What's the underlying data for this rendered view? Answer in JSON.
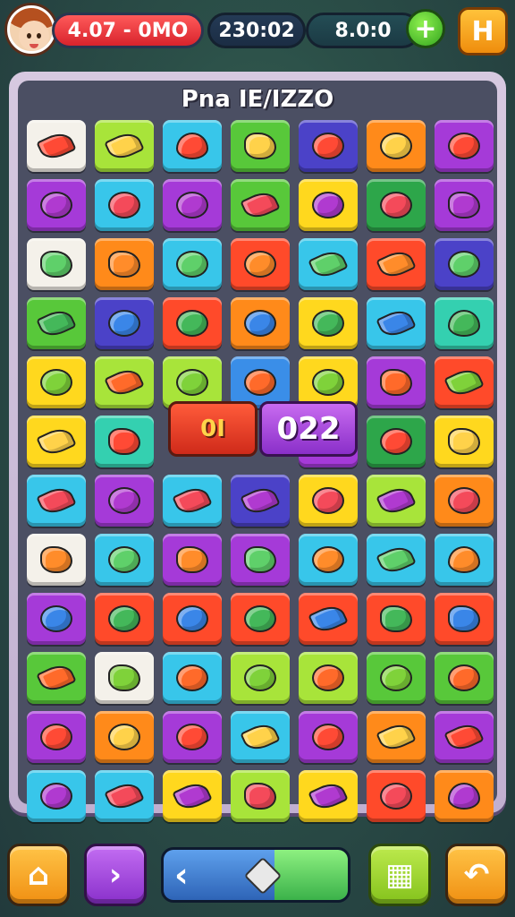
{
  "hud": {
    "lives_text": "4.07 - 0MO",
    "timer_text": "230:02",
    "coins_text": "8.0:0",
    "plus_label": "+",
    "menu_label": "H"
  },
  "board": {
    "title": "Pna IE/IZZO",
    "combo_text": "0I",
    "score_popup": "022",
    "tiles": [
      [
        "white",
        "lime",
        "sky",
        "green",
        "indigo",
        "orange",
        "purple"
      ],
      [
        "purple",
        "sky",
        "purple",
        "green",
        "yellow",
        "dgreen",
        "purple"
      ],
      [
        "white",
        "orange",
        "sky",
        "red",
        "sky",
        "red",
        "indigo"
      ],
      [
        "green",
        "indigo",
        "red",
        "orange",
        "yellow",
        "sky",
        "teal"
      ],
      [
        "yellow",
        "lime",
        "lime",
        "blue",
        "yellow",
        "purple",
        "red"
      ],
      [
        "yellow",
        "teal",
        "",
        "",
        "purple",
        "dgreen",
        "yellow"
      ],
      [
        "sky",
        "purple",
        "sky",
        "indigo",
        "yellow",
        "lime",
        "orange"
      ],
      [
        "white",
        "sky",
        "purple",
        "purple",
        "sky",
        "sky",
        "sky"
      ],
      [
        "purple",
        "red",
        "red",
        "red",
        "red",
        "red",
        "red"
      ],
      [
        "green",
        "white",
        "sky",
        "lime",
        "lime",
        "green",
        "green"
      ],
      [
        "purple",
        "orange",
        "purple",
        "sky",
        "purple",
        "orange",
        "purple"
      ],
      [
        "sky",
        "sky",
        "yellow",
        "lime",
        "yellow",
        "red",
        "orange"
      ]
    ],
    "icons": [
      [
        "leaf",
        "leaf",
        "heart",
        "blob",
        "round",
        "round",
        "round"
      ],
      [
        "round",
        "round",
        "round",
        "leaf",
        "round",
        "round",
        "blob"
      ],
      [
        "blob",
        "blob",
        "round",
        "round",
        "leaf",
        "leaf",
        "round"
      ],
      [
        "leaf",
        "round",
        "round",
        "round",
        "round",
        "leaf",
        "heart"
      ],
      [
        "round",
        "leaf",
        "round",
        "round",
        "round",
        "blob",
        "leaf"
      ],
      [
        "leaf",
        "blob",
        "",
        "",
        "round",
        "round",
        "blob"
      ],
      [
        "leaf",
        "round",
        "leaf",
        "leaf",
        "round",
        "leaf",
        "round"
      ],
      [
        "blob",
        "round",
        "blob",
        "blob",
        "round",
        "leaf",
        "heart"
      ],
      [
        "round",
        "round",
        "round",
        "round",
        "leaf",
        "blob",
        "blob"
      ],
      [
        "leaf",
        "blob",
        "round",
        "round",
        "round",
        "round",
        "round"
      ],
      [
        "round",
        "round",
        "round",
        "leaf",
        "round",
        "leaf",
        "leaf"
      ],
      [
        "round",
        "leaf",
        "leaf",
        "blob",
        "leaf",
        "round",
        "heart"
      ]
    ]
  },
  "colors": {
    "white": "#f4f1ea",
    "lime": "#a8e43a",
    "sky": "#38c6ea",
    "green": "#58c83a",
    "indigo": "#4b42c8",
    "orange": "#ff8a1a",
    "purple": "#a53ad8",
    "yellow": "#ffd81e",
    "dgreen": "#2da64a",
    "red": "#ff4a2a",
    "teal": "#34d0b0",
    "blue": "#3a8ee8"
  },
  "icon_colors": [
    "#ff4a35",
    "#ff8c2a",
    "#7fd23a",
    "#b03ad0",
    "#3a86e8",
    "#ffd24a",
    "#5fd06a",
    "#ff6a2a",
    "#f44a5a",
    "#44b85a"
  ],
  "bottom": {
    "home_label": "⌂",
    "next_label": "›",
    "slider_left": "‹",
    "slider_value": 0.6,
    "bag_label": "▦",
    "back_label": "↶"
  }
}
